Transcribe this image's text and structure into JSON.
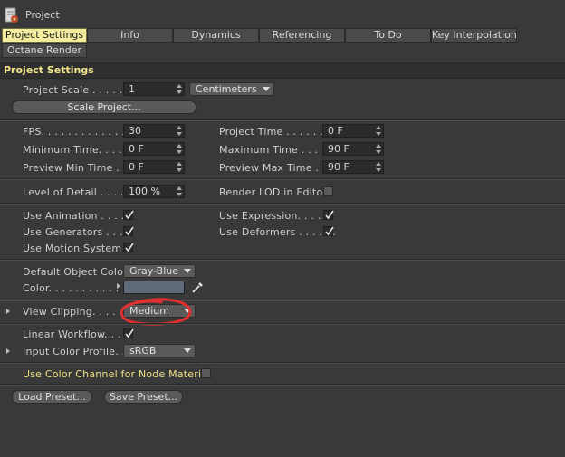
{
  "window": {
    "title": "Project"
  },
  "tabs": [
    {
      "label": "Project Settings",
      "active": true
    },
    {
      "label": "Info"
    },
    {
      "label": "Dynamics"
    },
    {
      "label": "Referencing"
    },
    {
      "label": "To Do"
    },
    {
      "label": "Key Interpolation"
    },
    {
      "label": "Octane Render"
    }
  ],
  "section": {
    "title": "Project Settings"
  },
  "project_scale": {
    "label": "Project Scale . . . . . . .",
    "value": "1",
    "unit": "Centimeters"
  },
  "scale_button": "Scale Project...",
  "timing": {
    "fps": {
      "label": "FPS. . . . . . . . . . . . . . .",
      "value": "30"
    },
    "project_time": {
      "label": "Project Time . . . . . . . .",
      "value": "0 F"
    },
    "min_time": {
      "label": "Minimum Time. . . . . .",
      "value": "0 F"
    },
    "max_time": {
      "label": "Maximum Time . . . . . .",
      "value": "90 F"
    },
    "preview_min": {
      "label": "Preview Min Time . .",
      "value": "0 F"
    },
    "preview_max": {
      "label": "Preview Max Time . . .",
      "value": "90 F"
    }
  },
  "lod": {
    "label": "Level of Detail . . . . .",
    "value": "100 %",
    "render_lod_label": "Render LOD in Editor"
  },
  "toggles": {
    "use_animation": "Use Animation . . . . .",
    "use_generators": "Use Generators . . . .",
    "use_motion": "Use Motion System",
    "use_expression": "Use Expression. . . . . .",
    "use_deformers": "Use Deformers . . . . . ."
  },
  "object_color": {
    "default_label": "Default Object Color",
    "default_value": "Gray-Blue",
    "color_label": "Color. . . . . . . . . . . . .",
    "swatch": "#5f6b78"
  },
  "view_clipping": {
    "label": "View Clipping. . . . . . .",
    "value": "Medium"
  },
  "linear_workflow": {
    "label": "Linear Workflow. . . ."
  },
  "input_color": {
    "label": "Input Color Profile. . .",
    "value": "sRGB"
  },
  "node_material": {
    "label": "Use Color Channel for Node Material"
  },
  "presets": {
    "load": "Load Preset...",
    "save": "Save Preset..."
  },
  "colors": {
    "active_tab": "#f3ec9c",
    "section_title": "#f3e58a",
    "annotation": "#e0302f"
  }
}
